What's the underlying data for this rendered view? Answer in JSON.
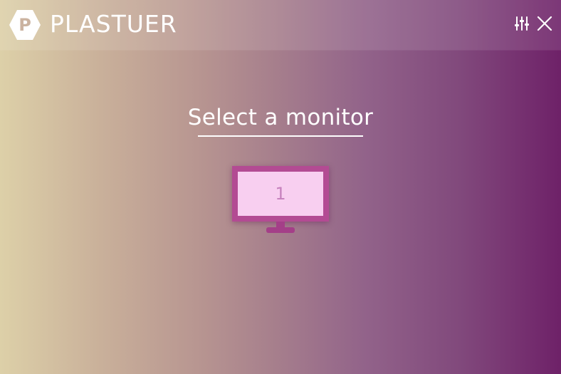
{
  "app": {
    "title": "PLASTUER",
    "logo_letter": "P"
  },
  "toolbar": {
    "settings_icon": "sliders-icon",
    "close_icon": "close-icon"
  },
  "main": {
    "heading": "Select a monitor",
    "monitors": [
      {
        "label": "1"
      }
    ]
  },
  "colors": {
    "gradient_start": "#ddd0a8",
    "gradient_end": "#6e2168",
    "monitor_frame": "#b34b93",
    "monitor_screen": "#f8cff0",
    "monitor_number": "#c782be"
  }
}
